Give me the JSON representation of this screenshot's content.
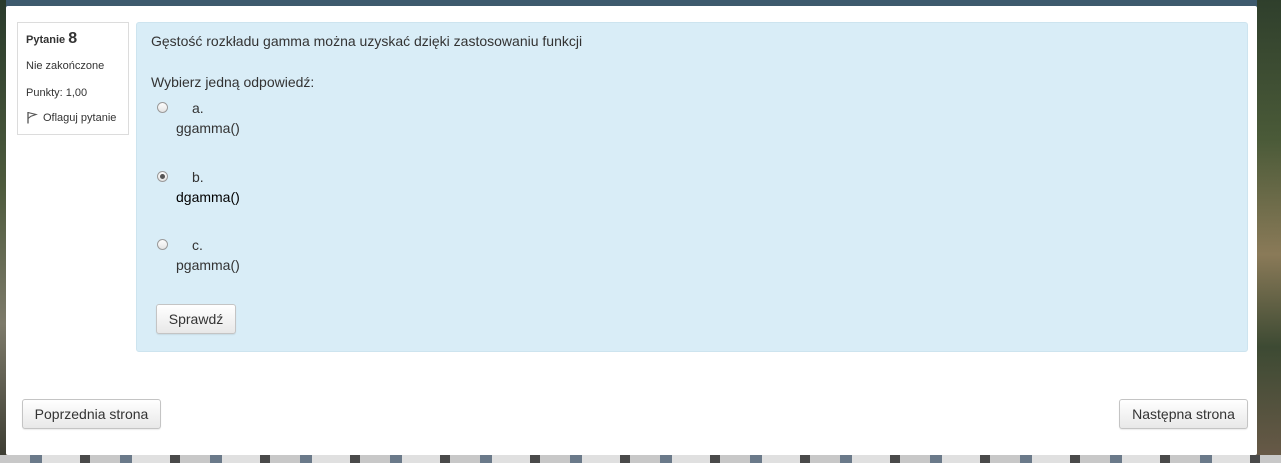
{
  "question_info": {
    "label": "Pytanie",
    "number": "8",
    "state": "Nie zakończone",
    "grade": "Punkty: 1,00",
    "flag_label": "Oflaguj pytanie",
    "flag_icon": "flag-icon"
  },
  "question": {
    "text": "Gęstość rozkładu gamma można uzyskać dzięki zastosowaniu funkcji",
    "prompt": "Wybierz jedną odpowiedź:",
    "options": [
      {
        "letter": "a.",
        "answer": "ggamma()",
        "selected": false
      },
      {
        "letter": "b.",
        "answer": "dgamma()",
        "selected": true
      },
      {
        "letter": "c.",
        "answer": "pgamma()",
        "selected": false
      }
    ],
    "check_label": "Sprawdź"
  },
  "navigation": {
    "prev_label": "Poprzednia strona",
    "next_label": "Następna strona"
  },
  "colors": {
    "question_bg": "#d9edf7",
    "card_bg": "#ffffff",
    "text": "#333333"
  }
}
